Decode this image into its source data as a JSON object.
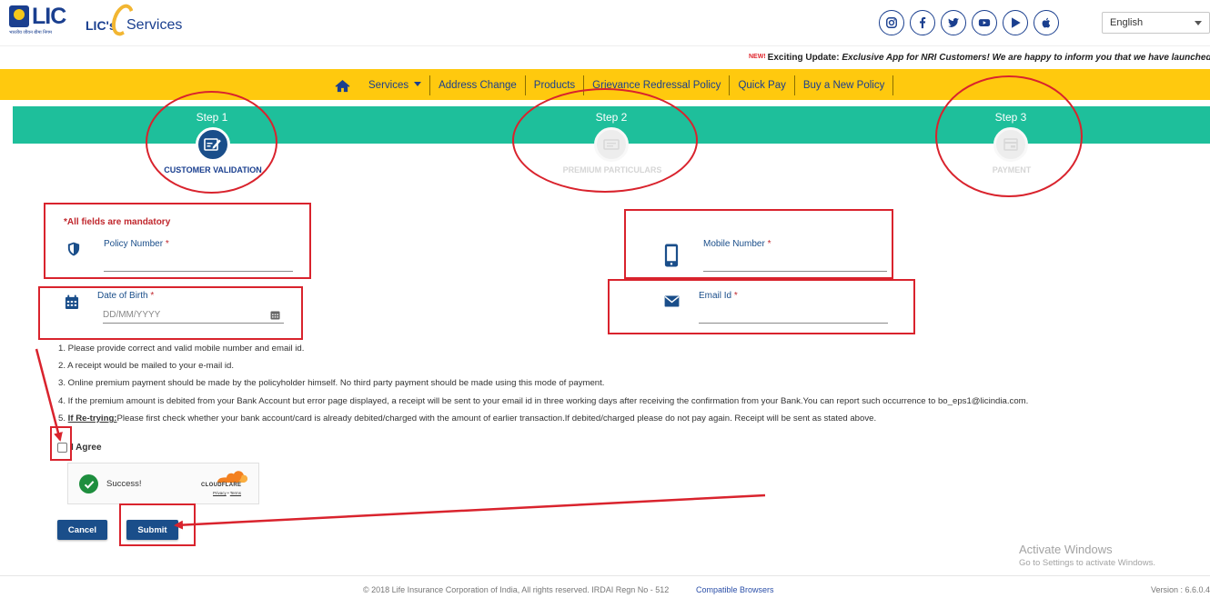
{
  "header": {
    "lic_logo_text": "LIC",
    "lic_logo_subtext": "भारतीय जीवन बीमा निगम",
    "eservices_prefix": "LIC's",
    "eservices_text": "Services",
    "social_icons": [
      "instagram-icon",
      "facebook-icon",
      "twitter-icon",
      "youtube-icon",
      "play-store-icon",
      "apple-icon"
    ],
    "language": {
      "selected": "English"
    }
  },
  "ticker": {
    "new_tag": "NEW!",
    "text_bold": "Exciting Update:",
    "text_italic": "Exclusive App for NRI Customers! We are happy to inform you that we have launched a"
  },
  "nav": {
    "items": [
      "Services",
      "Address Change",
      "Products",
      "Grievance Redressal Policy",
      "Quick Pay",
      "Buy a New Policy"
    ]
  },
  "steps": [
    {
      "title": "Step 1",
      "label": "CUSTOMER VALIDATION",
      "status": "active"
    },
    {
      "title": "Step 2",
      "label": "PREMIUM PARTICULARS",
      "status": "inactive"
    },
    {
      "title": "Step 3",
      "label": "PAYMENT",
      "status": "inactive"
    }
  ],
  "form": {
    "mandatory_note": "*All fields are mandatory",
    "policy_number": {
      "label": "Policy Number",
      "required_mark": "*",
      "value": ""
    },
    "mobile_number": {
      "label": "Mobile Number",
      "required_mark": "*",
      "value": ""
    },
    "dob": {
      "label": "Date of Birth",
      "required_mark": "*",
      "placeholder": "DD/MM/YYYY",
      "value": ""
    },
    "email": {
      "label": "Email Id",
      "required_mark": "*",
      "value": ""
    }
  },
  "instructions": {
    "items": [
      "1. Please provide correct and valid mobile number and email id.",
      "2. A receipt would be mailed to your e-mail id.",
      "3. Online premium payment should be made by the policyholder himself. No third party payment should be made using this mode of payment.",
      "4. If the premium amount is debited from your Bank Account but error page displayed, a receipt will be sent to your email id in three working days after receiving the confirmation from your Bank.You can report such occurrence to bo_eps1@licindia.com."
    ],
    "retry_prefix": "5. ",
    "retry_label": "If Re-trying:",
    "retry_text": "Please first check whether your bank account/card is already debited/charged with the amount of earlier transaction.If debited/charged please do not pay again. Receipt will be sent as stated above."
  },
  "agree": {
    "label": "I Agree",
    "checked": false
  },
  "captcha": {
    "status": "Success!",
    "brand": "CLOUDFLARE",
    "privacy": "Privacy",
    "separator": "•",
    "terms": "Terms"
  },
  "buttons": {
    "cancel": "Cancel",
    "submit": "Submit"
  },
  "watermark": {
    "title": "Activate Windows",
    "subtitle": "Go to Settings to activate Windows."
  },
  "footer": {
    "copyright": "© 2018 Life Insurance Corporation of India, All rights reserved. IRDAI Regn No - 512",
    "compatible_link": "Compatible Browsers",
    "version": "Version : 6.6.0.4"
  },
  "colors": {
    "primary_blue": "#1a4e8a",
    "nav_yellow": "#ffc90e",
    "step_green": "#1ebf9b",
    "annotation_red": "#d9232d"
  }
}
